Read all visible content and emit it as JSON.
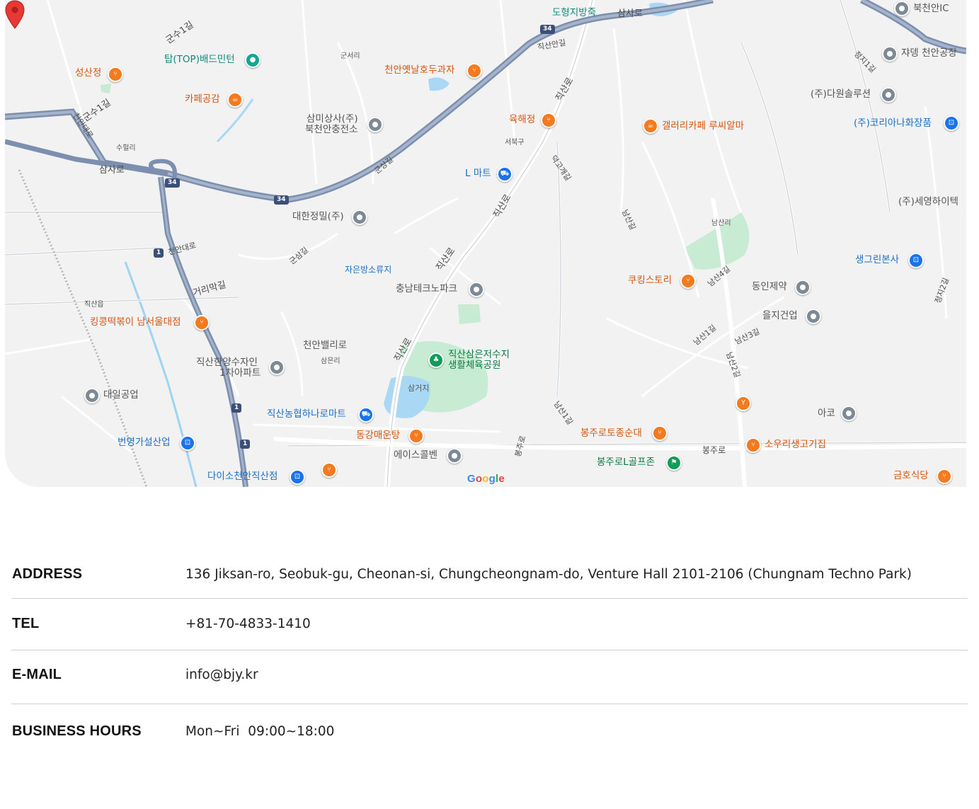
{
  "map": {
    "watermark": "Google",
    "pois": [
      {
        "label": "성산정",
        "color": "orange",
        "icon": "restaurant-icon"
      },
      {
        "label": "탑(TOP)배드민턴",
        "color": "teal",
        "icon": "sports-icon"
      },
      {
        "label": "카페공감",
        "color": "orange",
        "icon": "cafe-icon"
      },
      {
        "label": "천안옛날호두과자",
        "color": "orange",
        "icon": "restaurant-icon"
      },
      {
        "label": "삼미상사(주)",
        "color": "gray",
        "icon": "place-icon"
      },
      {
        "label": "북천안충전소",
        "color": "gray",
        "icon": "place-icon"
      },
      {
        "label": "육해정",
        "color": "orange",
        "icon": "restaurant-icon"
      },
      {
        "label": "L 마트",
        "color": "blue",
        "icon": "cart-icon"
      },
      {
        "label": "대한정밀(주)",
        "color": "gray",
        "icon": "place-icon"
      },
      {
        "label": "자은방소류지",
        "color": "blue",
        "icon": ""
      },
      {
        "label": "충남테크노파크",
        "color": "gray",
        "icon": "place-icon"
      },
      {
        "label": "킹콩떡볶이 남서울대점",
        "color": "orange",
        "icon": "restaurant-icon"
      },
      {
        "label": "천안밸리로",
        "color": "gray",
        "icon": ""
      },
      {
        "label": "직산한양수자인",
        "color": "gray",
        "icon": "place-icon"
      },
      {
        "label": "1차아파트",
        "color": "gray",
        "icon": ""
      },
      {
        "label": "직산삼은저수지",
        "color": "green",
        "icon": "park-icon"
      },
      {
        "label": "생활체육공원",
        "color": "green",
        "icon": ""
      },
      {
        "label": "삼거지",
        "color": "gray",
        "icon": ""
      },
      {
        "label": "대일공업",
        "color": "gray",
        "icon": "place-icon"
      },
      {
        "label": "직산농협하나로마트",
        "color": "blue",
        "icon": "cart-icon"
      },
      {
        "label": "동강매운탕",
        "color": "orange",
        "icon": "restaurant-icon"
      },
      {
        "label": "번영가설산업",
        "color": "blue",
        "icon": "shop-icon"
      },
      {
        "label": "에이스콜벤",
        "color": "gray",
        "icon": "place-icon"
      },
      {
        "label": "다이소천안직산점",
        "color": "blue",
        "icon": "shop-icon"
      },
      {
        "label": "봉주로토종순대",
        "color": "orange",
        "icon": "restaurant-icon"
      },
      {
        "label": "봉주로L골프존",
        "color": "green",
        "icon": "golf-icon"
      },
      {
        "label": "소우리생고기집",
        "color": "orange",
        "icon": "restaurant-icon"
      },
      {
        "label": "아코",
        "color": "gray",
        "icon": "place-icon"
      },
      {
        "label": "금호식당",
        "color": "orange",
        "icon": "restaurant-icon"
      },
      {
        "label": "쿠킹스토리",
        "color": "orange",
        "icon": "restaurant-icon"
      },
      {
        "label": "동인제약",
        "color": "gray",
        "icon": "place-icon"
      },
      {
        "label": "을지건업",
        "color": "gray",
        "icon": "place-icon"
      },
      {
        "label": "생그린본사",
        "color": "blue",
        "icon": "shop-icon"
      },
      {
        "label": "(주)세영하이텍",
        "color": "gray",
        "icon": ""
      },
      {
        "label": "(주)코리아나화장품",
        "color": "blue",
        "icon": "shop-icon"
      },
      {
        "label": "(주)다원솔루션",
        "color": "gray",
        "icon": "place-icon"
      },
      {
        "label": "쟈뎅 천안공장",
        "color": "gray",
        "icon": "place-icon"
      },
      {
        "label": "북천안IC",
        "color": "gray",
        "icon": "place-icon"
      },
      {
        "label": "갤러리카페 루씨알마",
        "color": "orange",
        "icon": "cafe-icon"
      },
      {
        "label": "도형지방죽",
        "color": "teal",
        "icon": ""
      }
    ],
    "roads": [
      "삼사로",
      "삼사로",
      "군수1길",
      "군수1길",
      "천안대로",
      "천안대로",
      "직산로",
      "직산로",
      "직산로",
      "직산로",
      "거리막길",
      "군삼길",
      "군상길",
      "직산안길",
      "남산2길",
      "남산3길",
      "남산4길",
      "남산1길",
      "봉주로",
      "봉주로",
      "덕고개길",
      "남산길",
      "남산1길",
      "정지1길",
      "정지2길",
      "군서리",
      "서북구",
      "수헐리",
      "직산읍",
      "삼은리",
      "남산리"
    ],
    "shields": [
      "34",
      "34",
      "34",
      "1",
      "1",
      "1"
    ]
  },
  "info": {
    "address": {
      "label": "ADDRESS",
      "value": "136 Jiksan-ro, Seobuk-gu, Cheonan-si, Chungcheongnam-do, Venture Hall 2101-2106 (Chungnam Techno Park)"
    },
    "tel": {
      "label": "TEL",
      "value": "+81-70-4833-1410"
    },
    "email": {
      "label": "E-MAIL",
      "value": "info@bjy.kr"
    },
    "hours": {
      "label": "BUSINESS HOURS",
      "value": "Mon~Fri  09:00~18:00"
    }
  }
}
